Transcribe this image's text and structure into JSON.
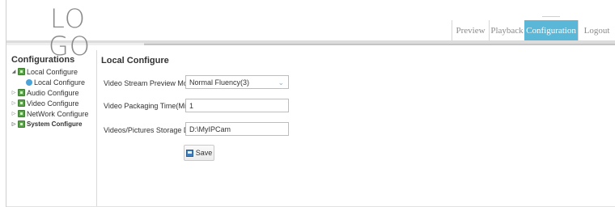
{
  "logo": {
    "line1": "LO",
    "line2": "GO"
  },
  "topnav": {
    "tabs": [
      {
        "label": "Preview",
        "active": false
      },
      {
        "label": "Playback",
        "active": false
      },
      {
        "label": "Configuration",
        "active": true
      },
      {
        "label": "Logout",
        "active": false
      }
    ],
    "active_color": "#5ab7d8"
  },
  "sidebar": {
    "title": "Configurations",
    "items": [
      {
        "label": "Local Configure",
        "expanded": true
      },
      {
        "label": "Local Configure"
      },
      {
        "label": "Audio Configure"
      },
      {
        "label": "Video Configure"
      },
      {
        "label": "NetWork Configure"
      },
      {
        "label": "System Configure"
      }
    ]
  },
  "main": {
    "title": "Local Configure",
    "preview_mode": {
      "label": "Video Stream Preview Mode",
      "value": "Normal Fluency(3)"
    },
    "packaging_time": {
      "label": "Video Packaging Time(Minutes)",
      "value": "1"
    },
    "storage_dir": {
      "label": "Videos/Pictures Storage Directory",
      "value": "D:\\MyIPCam"
    },
    "save_label": "Save"
  }
}
